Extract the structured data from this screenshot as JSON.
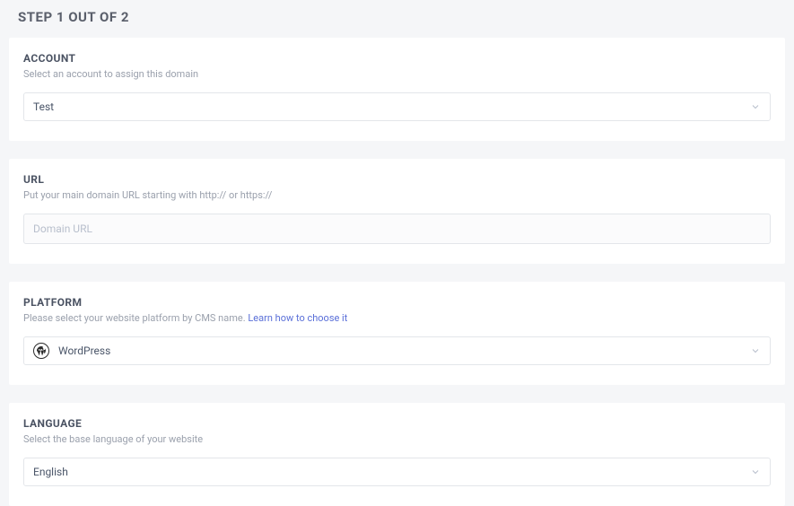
{
  "page": {
    "title": "STEP 1 OUT OF 2"
  },
  "account": {
    "label": "ACCOUNT",
    "hint": "Select an account to assign this domain",
    "selected": "Test"
  },
  "url": {
    "label": "URL",
    "hint": "Put your main domain URL starting with http:// or https://",
    "placeholder": "Domain URL",
    "value": ""
  },
  "platform": {
    "label": "PLATFORM",
    "hint_prefix": "Please select your website platform by CMS name. ",
    "hint_link": "Learn how to choose it",
    "selected": "WordPress",
    "icon": "wordpress-icon"
  },
  "language": {
    "label": "LANGUAGE",
    "hint": "Select the base language of your website",
    "selected": "English"
  }
}
